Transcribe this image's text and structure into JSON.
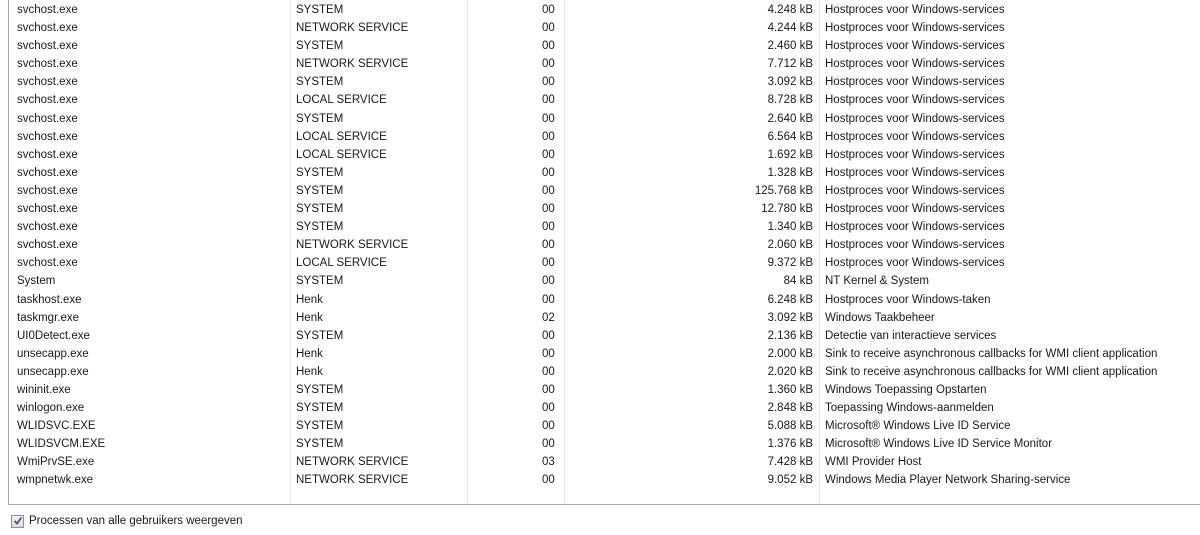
{
  "process_list": {
    "rows": [
      {
        "name": "svchost.exe",
        "user": "SYSTEM",
        "cpu": "00",
        "memory": "4.248 kB",
        "description": "Hostproces voor Windows-services"
      },
      {
        "name": "svchost.exe",
        "user": "NETWORK SERVICE",
        "cpu": "00",
        "memory": "4.244 kB",
        "description": "Hostproces voor Windows-services"
      },
      {
        "name": "svchost.exe",
        "user": "SYSTEM",
        "cpu": "00",
        "memory": "2.460 kB",
        "description": "Hostproces voor Windows-services"
      },
      {
        "name": "svchost.exe",
        "user": "NETWORK SERVICE",
        "cpu": "00",
        "memory": "7.712 kB",
        "description": "Hostproces voor Windows-services"
      },
      {
        "name": "svchost.exe",
        "user": "SYSTEM",
        "cpu": "00",
        "memory": "3.092 kB",
        "description": "Hostproces voor Windows-services"
      },
      {
        "name": "svchost.exe",
        "user": "LOCAL SERVICE",
        "cpu": "00",
        "memory": "8.728 kB",
        "description": "Hostproces voor Windows-services"
      },
      {
        "name": "svchost.exe",
        "user": "SYSTEM",
        "cpu": "00",
        "memory": "2.640 kB",
        "description": "Hostproces voor Windows-services"
      },
      {
        "name": "svchost.exe",
        "user": "LOCAL SERVICE",
        "cpu": "00",
        "memory": "6.564 kB",
        "description": "Hostproces voor Windows-services"
      },
      {
        "name": "svchost.exe",
        "user": "LOCAL SERVICE",
        "cpu": "00",
        "memory": "1.692 kB",
        "description": "Hostproces voor Windows-services"
      },
      {
        "name": "svchost.exe",
        "user": "SYSTEM",
        "cpu": "00",
        "memory": "1.328 kB",
        "description": "Hostproces voor Windows-services"
      },
      {
        "name": "svchost.exe",
        "user": "SYSTEM",
        "cpu": "00",
        "memory": "125.768 kB",
        "description": "Hostproces voor Windows-services"
      },
      {
        "name": "svchost.exe",
        "user": "SYSTEM",
        "cpu": "00",
        "memory": "12.780 kB",
        "description": "Hostproces voor Windows-services"
      },
      {
        "name": "svchost.exe",
        "user": "SYSTEM",
        "cpu": "00",
        "memory": "1.340 kB",
        "description": "Hostproces voor Windows-services"
      },
      {
        "name": "svchost.exe",
        "user": "NETWORK SERVICE",
        "cpu": "00",
        "memory": "2.060 kB",
        "description": "Hostproces voor Windows-services"
      },
      {
        "name": "svchost.exe",
        "user": "LOCAL SERVICE",
        "cpu": "00",
        "memory": "9.372 kB",
        "description": "Hostproces voor Windows-services"
      },
      {
        "name": "System",
        "user": "SYSTEM",
        "cpu": "00",
        "memory": "84 kB",
        "description": "NT Kernel & System"
      },
      {
        "name": "taskhost.exe",
        "user": "Henk",
        "cpu": "00",
        "memory": "6.248 kB",
        "description": "Hostproces voor Windows-taken"
      },
      {
        "name": "taskmgr.exe",
        "user": "Henk",
        "cpu": "02",
        "memory": "3.092 kB",
        "description": "Windows Taakbeheer"
      },
      {
        "name": "UI0Detect.exe",
        "user": "SYSTEM",
        "cpu": "00",
        "memory": "2.136 kB",
        "description": "Detectie van interactieve services"
      },
      {
        "name": "unsecapp.exe",
        "user": "Henk",
        "cpu": "00",
        "memory": "2.000 kB",
        "description": "Sink to receive asynchronous callbacks for WMI client application"
      },
      {
        "name": "unsecapp.exe",
        "user": "Henk",
        "cpu": "00",
        "memory": "2.020 kB",
        "description": "Sink to receive asynchronous callbacks for WMI client application"
      },
      {
        "name": "wininit.exe",
        "user": "SYSTEM",
        "cpu": "00",
        "memory": "1.360 kB",
        "description": "Windows Toepassing Opstarten"
      },
      {
        "name": "winlogon.exe",
        "user": "SYSTEM",
        "cpu": "00",
        "memory": "2.848 kB",
        "description": "Toepassing Windows-aanmelden"
      },
      {
        "name": "WLIDSVC.EXE",
        "user": "SYSTEM",
        "cpu": "00",
        "memory": "5.088 kB",
        "description": "Microsoft® Windows Live ID Service"
      },
      {
        "name": "WLIDSVCM.EXE",
        "user": "SYSTEM",
        "cpu": "00",
        "memory": "1.376 kB",
        "description": "Microsoft® Windows Live ID Service Monitor"
      },
      {
        "name": "WmiPrvSE.exe",
        "user": "NETWORK SERVICE",
        "cpu": "03",
        "memory": "7.428 kB",
        "description": "WMI Provider Host"
      },
      {
        "name": "wmpnetwk.exe",
        "user": "NETWORK SERVICE",
        "cpu": "00",
        "memory": "9.052 kB",
        "description": "Windows Media Player Network Sharing-service"
      }
    ]
  },
  "footer": {
    "show_all_users_label": "Processen van alle gebruikers weergeven",
    "show_all_users_checked": true
  },
  "icons": {
    "checkbox_check": "checkmark-icon"
  },
  "colors": {
    "check": "#2a4f8f",
    "separator": "#ececec"
  }
}
